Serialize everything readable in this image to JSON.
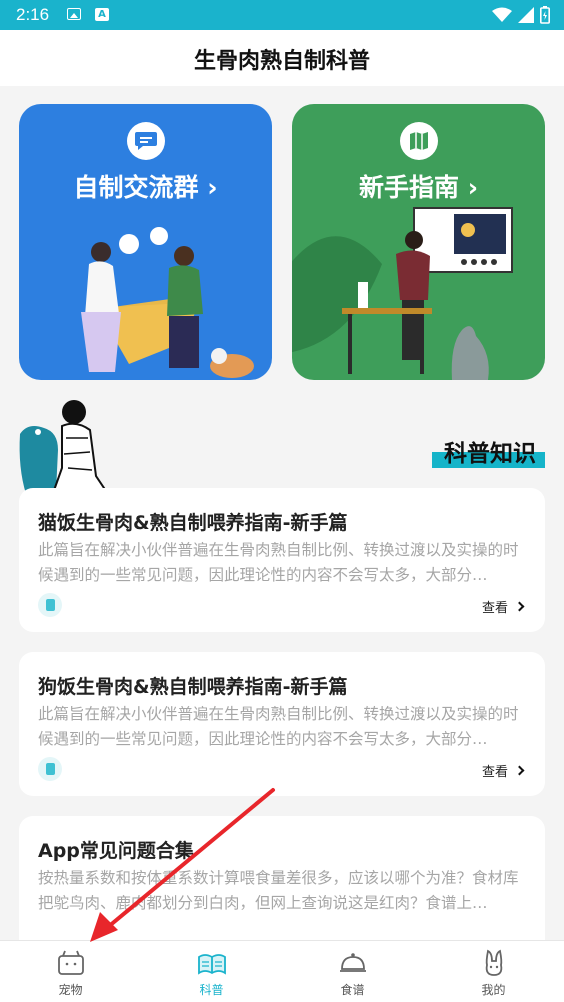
{
  "status_bar": {
    "time": "2:16"
  },
  "header": {
    "title": "生骨肉熟自制科普"
  },
  "banners": [
    {
      "label": "自制交流群 ›",
      "color": "#2d7fe0",
      "icon": "chat-bubble-icon"
    },
    {
      "label": "新手指南 ›",
      "color": "#3e9e5a",
      "icon": "book-map-icon"
    }
  ],
  "section": {
    "title": "科普知识",
    "accent": "#15b4c9"
  },
  "articles": [
    {
      "title": "猫饭生骨肉&熟自制喂养指南-新手篇",
      "desc": "此篇旨在解决小伙伴普遍在生骨肉熟自制比例、转换过渡以及实操的时候遇到的一些常见问题，因此理论性的内容不会写太多，大部分…",
      "view": "查看"
    },
    {
      "title": "狗饭生骨肉&熟自制喂养指南-新手篇",
      "desc": "此篇旨在解决小伙伴普遍在生骨肉熟自制比例、转换过渡以及实操的时候遇到的一些常见问题，因此理论性的内容不会写太多，大部分…",
      "view": "查看"
    },
    {
      "title": "App常见问题合集",
      "desc": "按热量系数和按体重系数计算喂食量差很多，应该以哪个为准？食材库把鸵鸟肉、鹿肉都划分到白肉，但网上查询说这是红肉？食谱上…",
      "view": ""
    }
  ],
  "nav": [
    {
      "label": "宠物",
      "icon": "pet-box-icon",
      "active": false
    },
    {
      "label": "科普",
      "icon": "open-book-icon",
      "active": true
    },
    {
      "label": "食谱",
      "icon": "food-cloche-icon",
      "active": false
    },
    {
      "label": "我的",
      "icon": "bunny-profile-icon",
      "active": false
    }
  ],
  "colors": {
    "accent": "#1ab3cc",
    "annotation": "#e8262b"
  }
}
